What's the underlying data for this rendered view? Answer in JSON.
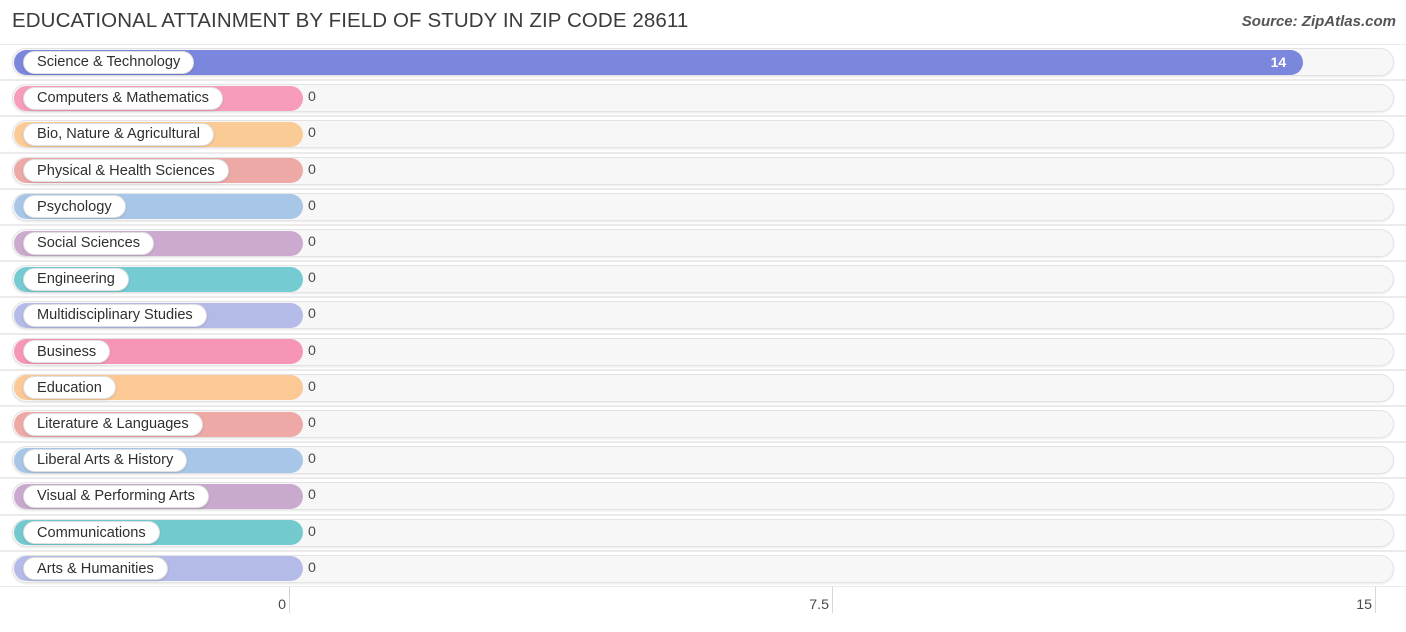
{
  "header": {
    "title": "EDUCATIONAL ATTAINMENT BY FIELD OF STUDY IN ZIP CODE 28611",
    "source": "Source: ZipAtlas.com"
  },
  "chart_data": {
    "type": "bar",
    "orientation": "horizontal",
    "title": "EDUCATIONAL ATTAINMENT BY FIELD OF STUDY IN ZIP CODE 28611",
    "subtitle": "",
    "xlabel": "",
    "ylabel": "",
    "xlim": [
      0,
      15
    ],
    "xticks": [
      "0",
      "7.5",
      "15"
    ],
    "xtick_values": [
      0,
      7.5,
      15
    ],
    "grid": true,
    "legend": false,
    "categories": [
      "Science & Technology",
      "Computers & Mathematics",
      "Bio, Nature & Agricultural",
      "Physical & Health Sciences",
      "Psychology",
      "Social Sciences",
      "Engineering",
      "Multidisciplinary Studies",
      "Business",
      "Education",
      "Literature & Languages",
      "Liberal Arts & History",
      "Visual & Performing Arts",
      "Communications",
      "Arts & Humanities"
    ],
    "values": [
      14,
      0,
      0,
      0,
      0,
      0,
      0,
      0,
      0,
      0,
      0,
      0,
      0,
      0,
      0
    ],
    "value_labels": [
      "14",
      "0",
      "0",
      "0",
      "0",
      "0",
      "0",
      "0",
      "0",
      "0",
      "0",
      "0",
      "0",
      "0",
      "0"
    ],
    "bar_colors": [
      "#7b86dd",
      "#f79dbb",
      "#fbcb96",
      "#eda9a5",
      "#a7c6e8",
      "#ccaacf",
      "#75cbd2",
      "#b4bbe8",
      "#f795b6",
      "#fcc994",
      "#eea9a6",
      "#a7c6e8",
      "#c9a9cd",
      "#72cacf",
      "#b5bbe8"
    ]
  },
  "rows": [
    {
      "label": "Science & Technology",
      "value": 14,
      "value_label": "14",
      "color": "#7b86dd",
      "inside": true
    },
    {
      "label": "Computers & Mathematics",
      "value": 0,
      "value_label": "0",
      "color": "#f79dbb",
      "inside": false
    },
    {
      "label": "Bio, Nature & Agricultural",
      "value": 0,
      "value_label": "0",
      "color": "#fbcb96",
      "inside": false
    },
    {
      "label": "Physical & Health Sciences",
      "value": 0,
      "value_label": "0",
      "color": "#eda9a5",
      "inside": false
    },
    {
      "label": "Psychology",
      "value": 0,
      "value_label": "0",
      "color": "#a7c6e8",
      "inside": false
    },
    {
      "label": "Social Sciences",
      "value": 0,
      "value_label": "0",
      "color": "#ccaacf",
      "inside": false
    },
    {
      "label": "Engineering",
      "value": 0,
      "value_label": "0",
      "color": "#75cbd2",
      "inside": false
    },
    {
      "label": "Multidisciplinary Studies",
      "value": 0,
      "value_label": "0",
      "color": "#b4bbe8",
      "inside": false
    },
    {
      "label": "Business",
      "value": 0,
      "value_label": "0",
      "color": "#f795b6",
      "inside": false
    },
    {
      "label": "Education",
      "value": 0,
      "value_label": "0",
      "color": "#fcc994",
      "inside": false
    },
    {
      "label": "Literature & Languages",
      "value": 0,
      "value_label": "0",
      "color": "#eea9a6",
      "inside": false
    },
    {
      "label": "Liberal Arts & History",
      "value": 0,
      "value_label": "0",
      "color": "#a7c6e8",
      "inside": false
    },
    {
      "label": "Visual & Performing Arts",
      "value": 0,
      "value_label": "0",
      "color": "#c9a9cd",
      "inside": false
    },
    {
      "label": "Communications",
      "value": 0,
      "value_label": "0",
      "color": "#72cacf",
      "inside": false
    },
    {
      "label": "Arts & Humanities",
      "value": 0,
      "value_label": "0",
      "color": "#b5bbe8",
      "inside": false
    }
  ],
  "axis": {
    "ticks": [
      {
        "label": "0",
        "value": 0
      },
      {
        "label": "7.5",
        "value": 7.5
      },
      {
        "label": "15",
        "value": 15
      }
    ]
  }
}
